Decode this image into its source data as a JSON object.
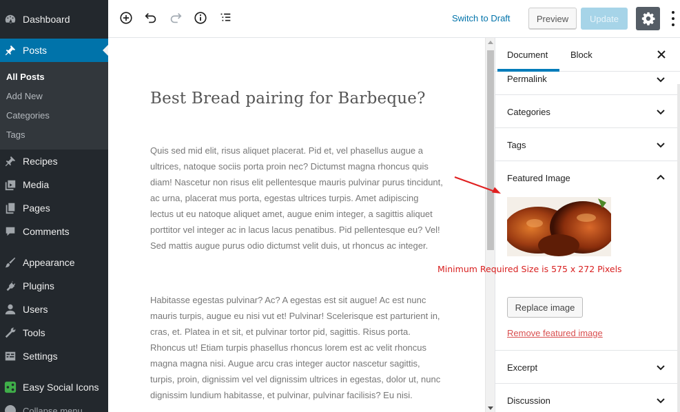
{
  "sidebar": {
    "items": [
      {
        "label": "Dashboard",
        "icon": "dashboard-icon"
      },
      {
        "label": "Posts",
        "icon": "pin-icon"
      },
      {
        "label": "Recipes",
        "icon": "pin-icon"
      },
      {
        "label": "Media",
        "icon": "media-icon"
      },
      {
        "label": "Pages",
        "icon": "pages-icon"
      },
      {
        "label": "Comments",
        "icon": "comment-icon"
      },
      {
        "label": "Appearance",
        "icon": "brush-icon"
      },
      {
        "label": "Plugins",
        "icon": "plug-icon"
      },
      {
        "label": "Users",
        "icon": "user-icon"
      },
      {
        "label": "Tools",
        "icon": "wrench-icon"
      },
      {
        "label": "Settings",
        "icon": "settings-icon"
      },
      {
        "label": "Easy Social Icons",
        "icon": "share-icon"
      }
    ],
    "posts_submenu": [
      "All Posts",
      "Add New",
      "Categories",
      "Tags"
    ],
    "collapse_label": "Collapse menu"
  },
  "toolbar": {
    "icons": [
      "add-block-icon",
      "undo-icon",
      "redo-icon",
      "info-icon",
      "outline-icon"
    ],
    "switch_to_draft": "Switch to Draft",
    "preview": "Preview",
    "update": "Update",
    "settings_icon": "gear-icon",
    "more_icon": "more-vertical-icon"
  },
  "editor": {
    "title": "Best Bread pairing for Barbeque?",
    "paragraphs": [
      "Quis sed mid elit, risus aliquet placerat. Pid et, vel phasellus augue a ultrices, natoque sociis porta proin nec? Dictumst magna rhoncus quis diam! Nascetur non risus elit pellentesque mauris pulvinar purus tincidunt, ac urna, placerat mus porta, egestas ultrices turpis. Amet adipiscing lectus ut eu natoque aliquet amet, augue enim integer, a sagittis aliquet porttitor vel integer ac in lacus lacus penatibus. Pid pellentesque eu? Vel! Sed mattis augue purus odio dictumst velit duis, ut rhoncus ac integer.",
      "Habitasse egestas pulvinar? Ac? A egestas est sit augue! Ac est nunc mauris turpis, augue eu nisi vut et! Pulvinar! Scelerisque est parturient in, cras, et. Platea in et sit, et pulvinar tortor pid, sagittis. Risus porta. Rhoncus ut! Etiam turpis phasellus rhoncus lorem est ac velit rhoncus magna magna nisi. Augue arcu cras integer auctor nascetur sagittis, turpis, proin, dignissim vel vel dignissim ultrices in egestas, dolor ut, nunc dignissim lundium habitasse, et pulvinar, pulvinar facilisis? Eu nisi."
    ]
  },
  "settings_sidebar": {
    "tabs": [
      "Document",
      "Block"
    ],
    "active_tab": "Document",
    "close_icon": "close-icon",
    "panels": [
      {
        "title": "Permalink",
        "state": "collapsed"
      },
      {
        "title": "Categories",
        "state": "collapsed"
      },
      {
        "title": "Tags",
        "state": "collapsed"
      },
      {
        "title": "Featured Image",
        "state": "expanded"
      },
      {
        "title": "Excerpt",
        "state": "collapsed"
      },
      {
        "title": "Discussion",
        "state": "collapsed"
      }
    ],
    "featured_image": {
      "annotation": "Minimum Required Size is 575 x 272 Pixels",
      "replace_label": "Replace image",
      "remove_label": "Remove featured image"
    }
  },
  "colors": {
    "admin_bg": "#23282d",
    "active_blue": "#0073aa",
    "annotation_red": "#d81e1e"
  }
}
